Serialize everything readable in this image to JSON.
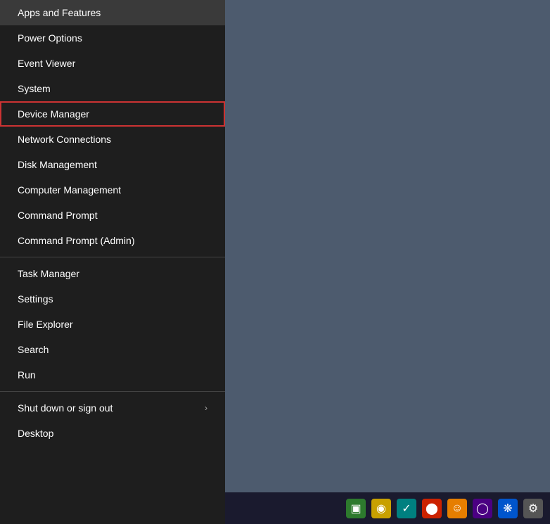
{
  "desktop": {
    "background_color": "#4d5b6e"
  },
  "context_menu": {
    "items": [
      {
        "id": "apps-features",
        "label": "Apps and Features",
        "has_arrow": false,
        "separator_after": false,
        "highlighted": false
      },
      {
        "id": "power-options",
        "label": "Power Options",
        "has_arrow": false,
        "separator_after": false,
        "highlighted": false
      },
      {
        "id": "event-viewer",
        "label": "Event Viewer",
        "has_arrow": false,
        "separator_after": false,
        "highlighted": false
      },
      {
        "id": "system",
        "label": "System",
        "has_arrow": false,
        "separator_after": false,
        "highlighted": false
      },
      {
        "id": "device-manager",
        "label": "Device Manager",
        "has_arrow": false,
        "separator_after": false,
        "highlighted": true
      },
      {
        "id": "network-connections",
        "label": "Network Connections",
        "has_arrow": false,
        "separator_after": false,
        "highlighted": false
      },
      {
        "id": "disk-management",
        "label": "Disk Management",
        "has_arrow": false,
        "separator_after": false,
        "highlighted": false
      },
      {
        "id": "computer-management",
        "label": "Computer Management",
        "has_arrow": false,
        "separator_after": false,
        "highlighted": false
      },
      {
        "id": "command-prompt",
        "label": "Command Prompt",
        "has_arrow": false,
        "separator_after": false,
        "highlighted": false
      },
      {
        "id": "command-prompt-admin",
        "label": "Command Prompt (Admin)",
        "has_arrow": false,
        "separator_after": true,
        "highlighted": false
      },
      {
        "id": "task-manager",
        "label": "Task Manager",
        "has_arrow": false,
        "separator_after": false,
        "highlighted": false
      },
      {
        "id": "settings",
        "label": "Settings",
        "has_arrow": false,
        "separator_after": false,
        "highlighted": false
      },
      {
        "id": "file-explorer",
        "label": "File Explorer",
        "has_arrow": false,
        "separator_after": false,
        "highlighted": false
      },
      {
        "id": "search",
        "label": "Search",
        "has_arrow": false,
        "separator_after": false,
        "highlighted": false
      },
      {
        "id": "run",
        "label": "Run",
        "has_arrow": false,
        "separator_after": true,
        "highlighted": false
      },
      {
        "id": "shut-down",
        "label": "Shut down or sign out",
        "has_arrow": true,
        "separator_after": false,
        "highlighted": false
      },
      {
        "id": "desktop",
        "label": "Desktop",
        "has_arrow": false,
        "separator_after": false,
        "highlighted": false
      }
    ]
  },
  "taskbar": {
    "icons": [
      {
        "id": "icon-green",
        "color_class": "green",
        "symbol": "▣",
        "label": "app-icon-1"
      },
      {
        "id": "icon-yellow",
        "color_class": "yellow",
        "symbol": "◉",
        "label": "app-icon-2"
      },
      {
        "id": "icon-teal",
        "color_class": "teal",
        "symbol": "✓",
        "label": "app-icon-3"
      },
      {
        "id": "icon-red",
        "color_class": "red",
        "symbol": "⬤",
        "label": "app-icon-4"
      },
      {
        "id": "icon-orange",
        "color_class": "orange",
        "symbol": "☺",
        "label": "app-icon-5"
      },
      {
        "id": "icon-purple",
        "color_class": "purple",
        "symbol": "◯",
        "label": "app-icon-6"
      },
      {
        "id": "icon-blue",
        "color_class": "blue",
        "symbol": "❋",
        "label": "app-icon-7"
      },
      {
        "id": "icon-gray",
        "color_class": "gray",
        "symbol": "⚙",
        "label": "settings-icon"
      }
    ]
  }
}
